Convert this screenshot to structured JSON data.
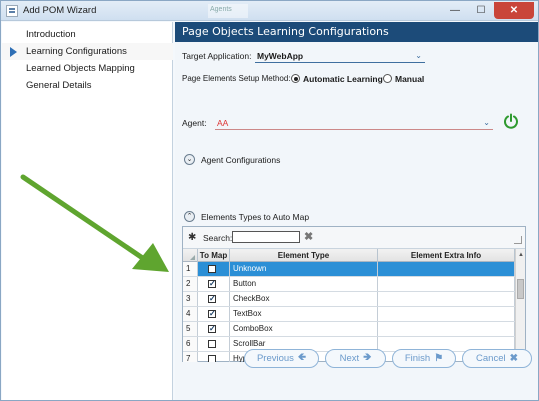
{
  "window": {
    "title": "Add POM Wizard",
    "ghost_tab": "Agents"
  },
  "sidebar": {
    "items": [
      {
        "label": "Introduction",
        "active": false
      },
      {
        "label": "Learning Configurations",
        "active": true
      },
      {
        "label": "Learned Objects Mapping",
        "active": false
      },
      {
        "label": "General Details",
        "active": false
      }
    ]
  },
  "main": {
    "header": "Page Objects Learning Configurations",
    "target_app_label": "Target Application:",
    "target_app_value": "MyWebApp",
    "setup_method_label": "Page Elements Setup Method:",
    "setup_options": [
      "Automatic Learning",
      "Manual"
    ],
    "setup_selected": "Automatic Learning",
    "agent_label": "Agent:",
    "agent_value": "AA",
    "agent_config_label": "Agent Configurations",
    "element_types_label": "Elements Types to Auto Map",
    "search_label": "Search:",
    "grid": {
      "columns": [
        "To Map",
        "Element Type",
        "Element Extra Info"
      ],
      "rows": [
        {
          "num": "1",
          "checked": false,
          "type": "Unknown",
          "extra": "",
          "selected": true
        },
        {
          "num": "2",
          "checked": true,
          "type": "Button",
          "extra": ""
        },
        {
          "num": "3",
          "checked": true,
          "type": "CheckBox",
          "extra": ""
        },
        {
          "num": "4",
          "checked": true,
          "type": "TextBox",
          "extra": ""
        },
        {
          "num": "5",
          "checked": true,
          "type": "ComboBox",
          "extra": ""
        },
        {
          "num": "6",
          "checked": false,
          "type": "ScrollBar",
          "extra": ""
        },
        {
          "num": "7",
          "checked": false,
          "type": "HyperLink",
          "extra": ""
        }
      ]
    }
  },
  "footer": {
    "previous": "Previous",
    "next": "Next",
    "finish": "Finish",
    "cancel": "Cancel"
  },
  "colors": {
    "header_bg": "#1c4b79",
    "selected_row": "#2b8fd6",
    "arrow": "#5fa52f",
    "power": "#2f9a2f",
    "button_text": "#6b9acb"
  }
}
